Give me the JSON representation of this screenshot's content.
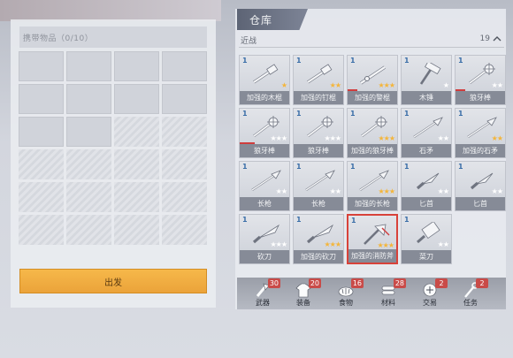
{
  "left": {
    "carry_label": "携带物品（0/10）",
    "depart_label": "出发"
  },
  "warehouse": {
    "title": "仓库",
    "category": "近战",
    "count": "19"
  },
  "items": [
    {
      "name": "加强的木棍",
      "count": "1",
      "stars": 1,
      "max": 1,
      "damage": 0
    },
    {
      "name": "加强的钉棍",
      "count": "1",
      "stars": 2,
      "max": 2,
      "damage": 0
    },
    {
      "name": "加强的警棍",
      "count": "1",
      "stars": 3,
      "max": 3,
      "damage": 0.2
    },
    {
      "name": "木锤",
      "count": "1",
      "stars": 0,
      "max": 1,
      "damage": 0
    },
    {
      "name": "狼牙棒",
      "count": "1",
      "stars": 0,
      "max": 2,
      "damage": 0.2
    },
    {
      "name": "狼牙棒",
      "count": "1",
      "stars": 0,
      "max": 3,
      "damage": 0.3
    },
    {
      "name": "狼牙棒",
      "count": "1",
      "stars": 0,
      "max": 3,
      "damage": 0
    },
    {
      "name": "加强的狼牙棒",
      "count": "1",
      "stars": 3,
      "max": 3,
      "damage": 0
    },
    {
      "name": "石矛",
      "count": "1",
      "stars": 0,
      "max": 2,
      "damage": 0
    },
    {
      "name": "加强的石矛",
      "count": "1",
      "stars": 2,
      "max": 2,
      "damage": 0
    },
    {
      "name": "长枪",
      "count": "1",
      "stars": 0,
      "max": 2,
      "damage": 0
    },
    {
      "name": "长枪",
      "count": "1",
      "stars": 0,
      "max": 2,
      "damage": 0
    },
    {
      "name": "加强的长枪",
      "count": "1",
      "stars": 3,
      "max": 3,
      "damage": 0
    },
    {
      "name": "匕首",
      "count": "1",
      "stars": 0,
      "max": 2,
      "damage": 0
    },
    {
      "name": "匕首",
      "count": "1",
      "stars": 0,
      "max": 2,
      "damage": 0
    },
    {
      "name": "砍刀",
      "count": "1",
      "stars": 0,
      "max": 3,
      "damage": 0
    },
    {
      "name": "加强的砍刀",
      "count": "1",
      "stars": 3,
      "max": 3,
      "damage": 0
    },
    {
      "name": "加强的消防斧",
      "count": "1",
      "stars": 3,
      "max": 3,
      "damage": 0,
      "selected": true
    },
    {
      "name": "菜刀",
      "count": "1",
      "stars": 0,
      "max": 2,
      "damage": 0
    }
  ],
  "tabs": [
    {
      "label": "武器",
      "badge": "30",
      "icon": "weapon-icon"
    },
    {
      "label": "装备",
      "badge": "20",
      "icon": "shirt-icon"
    },
    {
      "label": "食物",
      "badge": "16",
      "icon": "bread-icon"
    },
    {
      "label": "材料",
      "badge": "28",
      "icon": "wood-icon"
    },
    {
      "label": "交易",
      "badge": "2",
      "icon": "trade-icon"
    },
    {
      "label": "任务",
      "badge": "2",
      "icon": "quest-icon"
    }
  ],
  "colors": {
    "accent": "#eba33a",
    "star": "#f4b53a",
    "badge": "#c94b48",
    "selected": "#d8423a"
  }
}
